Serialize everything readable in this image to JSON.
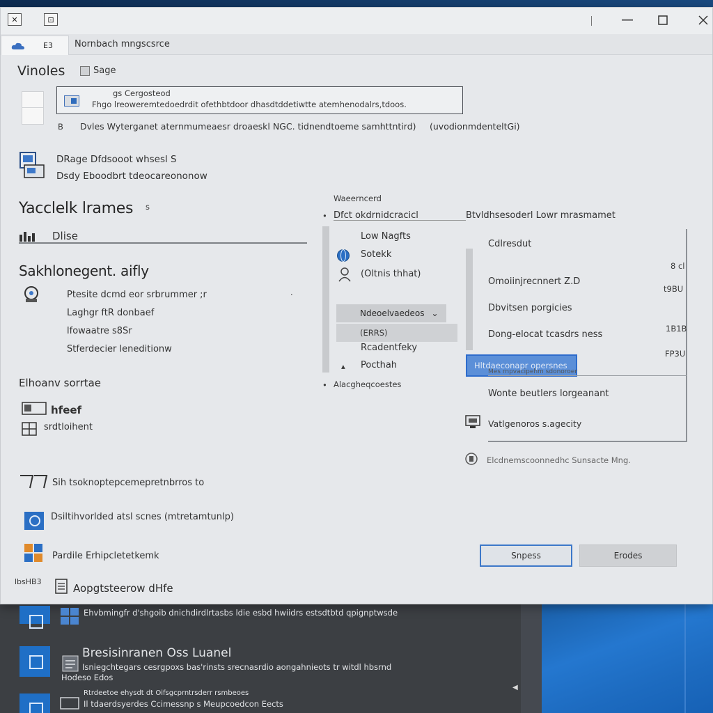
{
  "window": {
    "tab_label": "Nornbach mngscsrce",
    "titlebar_close_glyph": "✕",
    "titlebar_restore_glyph": "⊡",
    "tab_cloud_icon": "cloud-icon",
    "tab_aux_label": "E3"
  },
  "header": {
    "title": "Vinoles",
    "checkbox_label": "Sage"
  },
  "search": {
    "label": "gs Cergosteod",
    "value": "Fhgo lreoweremtedoedrdit ofethbtdoor dhasdtddetiwtte atemhenodalrs,tdoos."
  },
  "info_line": {
    "left": "Dvles Wyterganet aternmumeaesr droaeskl NGC. tidnendtoeme samhttntird)",
    "right": "(uvodionmdenteltGi)",
    "prefix": "B"
  },
  "device": {
    "line1": "DRage Dfdsooot whsesl S",
    "line2": "Dsdy Eboodbrt tdeocareononow"
  },
  "section_title": "Yacclelk lrames",
  "section_title_suffix": "s",
  "discs_label": "Dlise",
  "subsection_title": "Sakhlonegent. aifly",
  "settings_list": [
    "Ptesite dcmd eor srbrummer ;r",
    "Laghgr ftR donbaef",
    "lfowaatre s8Sr",
    "Stferdecier leneditionw"
  ],
  "environment_title": "Elhoanv sorrtae",
  "env_items": [
    {
      "label": "hfeef",
      "bold": true
    },
    {
      "label": "srdtloihent",
      "bold": false
    }
  ],
  "bottom_left_items": [
    "Sih tsoknoptepcemepretnbrros to",
    "Dsiltihvorlded atsl scnes (mtretamtunlp)",
    "Pardile Erhipcletetkemk",
    "Aopgtsteerow  dHfe"
  ],
  "bottom_left_prefix": "lbsHB3",
  "center_panel": {
    "header": "Waeerncerd",
    "subheader": "Dfct okdrnidcracicl",
    "items": [
      "Low Nagfts",
      "Sotekk",
      "(Oltnis thhat)",
      "Ndeoelvaedeos",
      "(ERRS)",
      "Rcadentfeky",
      "Pocthah",
      "Alacgheqcoestes"
    ],
    "dropdown_chevron": "⌄"
  },
  "right_panel": {
    "header": "Btvldhsesoderl Lowr mrasmamet",
    "rows": [
      {
        "label": "Cdlresdut",
        "value": ""
      },
      {
        "label": "",
        "value": "8 cl"
      },
      {
        "label": "Omoiinjrecnnert Z.D",
        "value": "t9BU"
      },
      {
        "label": "Dbvitsen porgicies",
        "value": ""
      },
      {
        "label": "Dong-elocat tcasdrs ness",
        "value": "1B1B"
      },
      {
        "label": "",
        "value": "FP3U"
      },
      {
        "label": "Wonte beutlers lorgeanant",
        "value": ""
      },
      {
        "label": "Vatlgenoros s.agecity",
        "value": ""
      }
    ],
    "selected_label": "Hltdaeconapr opersnes",
    "under_selected": "Mes rnpvacipehm sdonoroer",
    "footer_note": "Elcdnemscoonnedhc Sunsacte Mng."
  },
  "buttons": {
    "primary": "Snpess",
    "secondary": "Erodes"
  },
  "taskbar": {
    "item1_text": "Ehvbmingfr d'shgoib dnichdirdlrtasbs ldie esbd hwiidrs estsdtbtd qpignptwsde",
    "item2_title": "Bresisinranen Oss Luanel",
    "item2_line": "Isniegchtegars cesrgpoxs bas'rinsts srecnasrdio aongahnieots tr witdl hbsrnd",
    "item2_sub": "Hodeso Edos",
    "item3_line1": "Rtrdeetoe ehysdt dt Oifsgcprntrsderr rsmbeoes",
    "item3_line2": "Il tdaerdsyerdes Ccimessnp s Meupcoedcon Eects"
  },
  "colors": {
    "accent": "#2e6ccc",
    "window_bg": "#e6e8eb",
    "desktop_blue": "#1f6fc6"
  }
}
